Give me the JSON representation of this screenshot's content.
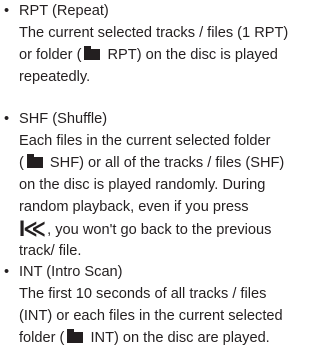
{
  "features": [
    {
      "title": "RPT (Repeat)",
      "lines": [
        {
          "parts": [
            {
              "t": "The current selected tracks / files (1 RPT)"
            }
          ]
        },
        {
          "parts": [
            {
              "t": "or folder ("
            },
            {
              "icon": "folder-icon"
            },
            {
              "t": " RPT) on the disc is played"
            }
          ]
        },
        {
          "parts": [
            {
              "t": "repeatedly."
            }
          ]
        }
      ]
    },
    {
      "title": "SHF (Shuffle)",
      "lines": [
        {
          "parts": [
            {
              "t": "Each files in the current selected folder"
            }
          ]
        },
        {
          "parts": [
            {
              "t": "("
            },
            {
              "icon": "folder-icon"
            },
            {
              "t": " SHF) or all of the tracks / files (SHF)"
            }
          ]
        },
        {
          "parts": [
            {
              "t": "on the disc is played randomly. During"
            }
          ]
        },
        {
          "parts": [
            {
              "t": "random playback, even if you press"
            }
          ]
        },
        {
          "parts": [
            {
              "icon": "previous-track-icon",
              "glyph": "I≪"
            },
            {
              "t": ", you won't go back to the previous"
            }
          ]
        },
        {
          "parts": [
            {
              "t": "track/ file."
            }
          ]
        }
      ]
    },
    {
      "title": "INT (Intro Scan)",
      "lines": [
        {
          "parts": [
            {
              "t": "The first 10 seconds of all tracks / files"
            }
          ]
        },
        {
          "parts": [
            {
              "t": "(INT) or each files in the current selected"
            }
          ]
        },
        {
          "parts": [
            {
              "t": "folder ("
            },
            {
              "icon": "folder-icon"
            },
            {
              "t": " INT) on the disc are played."
            }
          ]
        }
      ]
    }
  ]
}
